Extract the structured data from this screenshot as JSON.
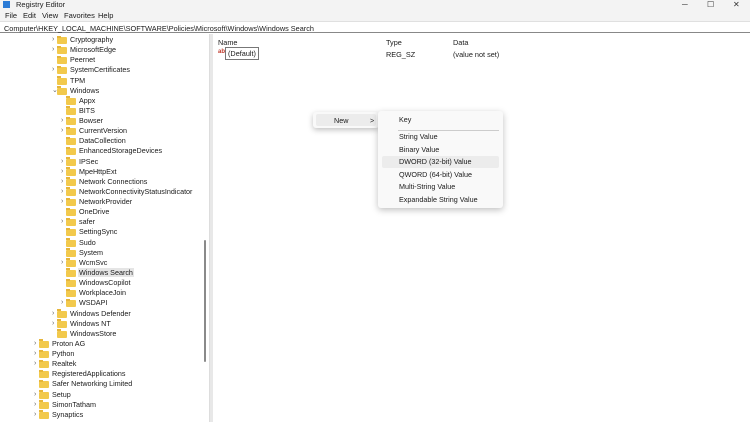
{
  "window": {
    "title": "Registry Editor",
    "controls": [
      "─",
      "☐",
      "✕"
    ]
  },
  "menu": [
    "File",
    "Edit",
    "View",
    "Favorites",
    "Help"
  ],
  "address": "Computer\\HKEY_LOCAL_MACHINE\\SOFTWARE\\Policies\\Microsoft\\Windows\\Windows Search",
  "tree": [
    {
      "label": "Cryptography",
      "level": 1,
      "chev": ">"
    },
    {
      "label": "MicrosoftEdge",
      "level": 1,
      "chev": ">"
    },
    {
      "label": "Peernet",
      "level": 1,
      "chev": ""
    },
    {
      "label": "SystemCertificates",
      "level": 1,
      "chev": ">"
    },
    {
      "label": "TPM",
      "level": 1,
      "chev": ""
    },
    {
      "label": "Windows",
      "level": 1,
      "chev": "v"
    },
    {
      "label": "Appx",
      "level": 2,
      "chev": ""
    },
    {
      "label": "BITS",
      "level": 2,
      "chev": ""
    },
    {
      "label": "Bowser",
      "level": 2,
      "chev": ">"
    },
    {
      "label": "CurrentVersion",
      "level": 2,
      "chev": ">"
    },
    {
      "label": "DataCollection",
      "level": 2,
      "chev": ""
    },
    {
      "label": "EnhancedStorageDevices",
      "level": 2,
      "chev": ""
    },
    {
      "label": "IPSec",
      "level": 2,
      "chev": ">"
    },
    {
      "label": "MpeHttpExt",
      "level": 2,
      "chev": ">"
    },
    {
      "label": "Network Connections",
      "level": 2,
      "chev": ">"
    },
    {
      "label": "NetworkConnectivityStatusIndicator",
      "level": 2,
      "chev": ">"
    },
    {
      "label": "NetworkProvider",
      "level": 2,
      "chev": ">"
    },
    {
      "label": "OneDrive",
      "level": 2,
      "chev": ""
    },
    {
      "label": "safer",
      "level": 2,
      "chev": ">"
    },
    {
      "label": "SettingSync",
      "level": 2,
      "chev": ""
    },
    {
      "label": "Sudo",
      "level": 2,
      "chev": ""
    },
    {
      "label": "System",
      "level": 2,
      "chev": ""
    },
    {
      "label": "WcmSvc",
      "level": 2,
      "chev": ">"
    },
    {
      "label": "Windows Search",
      "level": 2,
      "chev": "",
      "selected": true
    },
    {
      "label": "WindowsCopilot",
      "level": 2,
      "chev": ""
    },
    {
      "label": "WorkplaceJoin",
      "level": 2,
      "chev": ""
    },
    {
      "label": "WSDAPI",
      "level": 2,
      "chev": ">"
    },
    {
      "label": "Windows Defender",
      "level": 1,
      "chev": ">"
    },
    {
      "label": "Windows NT",
      "level": 1,
      "chev": ">"
    },
    {
      "label": "WindowsStore",
      "level": 1,
      "chev": ""
    },
    {
      "label": "Proton AG",
      "level": 0,
      "chev": ">"
    },
    {
      "label": "Python",
      "level": 0,
      "chev": ">"
    },
    {
      "label": "Realtek",
      "level": 0,
      "chev": ">"
    },
    {
      "label": "RegisteredApplications",
      "level": 0,
      "chev": ""
    },
    {
      "label": "Safer Networking Limited",
      "level": 0,
      "chev": ""
    },
    {
      "label": "Setup",
      "level": 0,
      "chev": ">"
    },
    {
      "label": "SimonTatham",
      "level": 0,
      "chev": ">"
    },
    {
      "label": "Synaptics",
      "level": 0,
      "chev": ">"
    }
  ],
  "list": {
    "headers": {
      "name": "Name",
      "type": "Type",
      "data": "Data"
    },
    "rows": [
      {
        "name": "(Default)",
        "type": "REG_SZ",
        "data": "(value not set)"
      }
    ]
  },
  "context_menu": {
    "new_label": "New",
    "arrow": ">"
  },
  "submenu": [
    "Key",
    "String Value",
    "Binary Value",
    "DWORD (32-bit) Value",
    "QWORD (64-bit) Value",
    "Multi-String Value",
    "Expandable String Value"
  ],
  "highlighted_submenu": "DWORD (32-bit) Value"
}
